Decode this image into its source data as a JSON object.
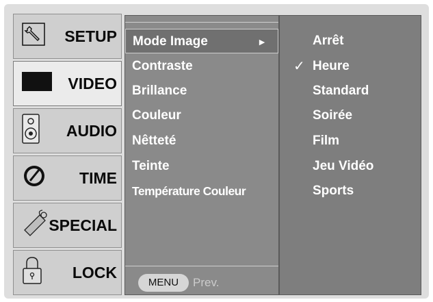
{
  "main_menu": [
    {
      "label": "SETUP",
      "icon": "wrench-icon"
    },
    {
      "label": "VIDEO",
      "icon": "tv-screen-icon"
    },
    {
      "label": "AUDIO",
      "icon": "speaker-icon"
    },
    {
      "label": "TIME",
      "icon": "clock-icon"
    },
    {
      "label": "SPECIAL",
      "icon": "tag-icon"
    },
    {
      "label": "LOCK",
      "icon": "padlock-icon"
    }
  ],
  "active_main": "VIDEO",
  "submenu": {
    "items": [
      {
        "label": "Mode Image",
        "arrow": "►"
      },
      {
        "label": "Contraste"
      },
      {
        "label": "Brillance"
      },
      {
        "label": "Couleur"
      },
      {
        "label": "Nêtteté"
      },
      {
        "label": "Teinte"
      },
      {
        "label": "Température Couleur"
      }
    ],
    "menu_key": "MENU",
    "prev_label": "Prev."
  },
  "options": {
    "items": [
      "Arrêt",
      "Heure",
      "Standard",
      "Soirée",
      "Film",
      "Jeu Vidéo",
      "Sports"
    ],
    "checked": "Heure",
    "check_mark": "✓"
  },
  "colors": {
    "frame": "#dedede",
    "main_item": "#cfcfcf",
    "submenu_bg": "#8a8a8a",
    "options_bg": "#7e7e7e",
    "text_light": "#ffffff"
  }
}
